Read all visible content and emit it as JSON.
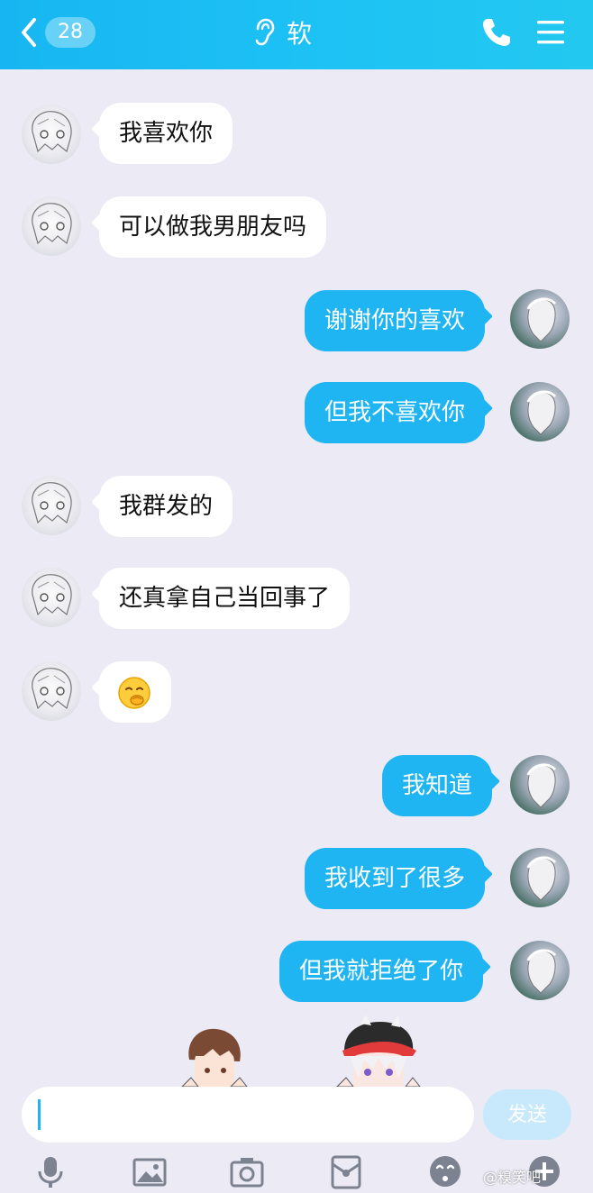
{
  "header": {
    "back_badge": "28",
    "title": "软"
  },
  "messages": [
    {
      "side": "in",
      "text": "我喜欢你"
    },
    {
      "side": "in",
      "text": "可以做我男朋友吗"
    },
    {
      "side": "out",
      "text": "谢谢你的喜欢"
    },
    {
      "side": "out",
      "text": "但我不喜欢你"
    },
    {
      "side": "in",
      "text": "我群发的"
    },
    {
      "side": "in",
      "text": "还真拿自己当回事了"
    },
    {
      "side": "in",
      "emoji": "smirk-face-emoji"
    },
    {
      "side": "out",
      "text": "我知道"
    },
    {
      "side": "out",
      "text": "我收到了很多"
    },
    {
      "side": "out",
      "text": "但我就拒绝了你"
    }
  ],
  "input": {
    "send_label": "发送"
  },
  "toolbar": [
    "microphone-icon",
    "image-icon",
    "camera-icon",
    "red-packet-icon",
    "emoji-icon",
    "plus-icon"
  ],
  "watermark": "@糗笑吧",
  "colors": {
    "header": "#1ec3f4",
    "outgoing_bubble": "#1fb4f2",
    "incoming_bubble": "#ffffff",
    "background": "#ebeaf5",
    "send_button": "#c7e9fb"
  }
}
